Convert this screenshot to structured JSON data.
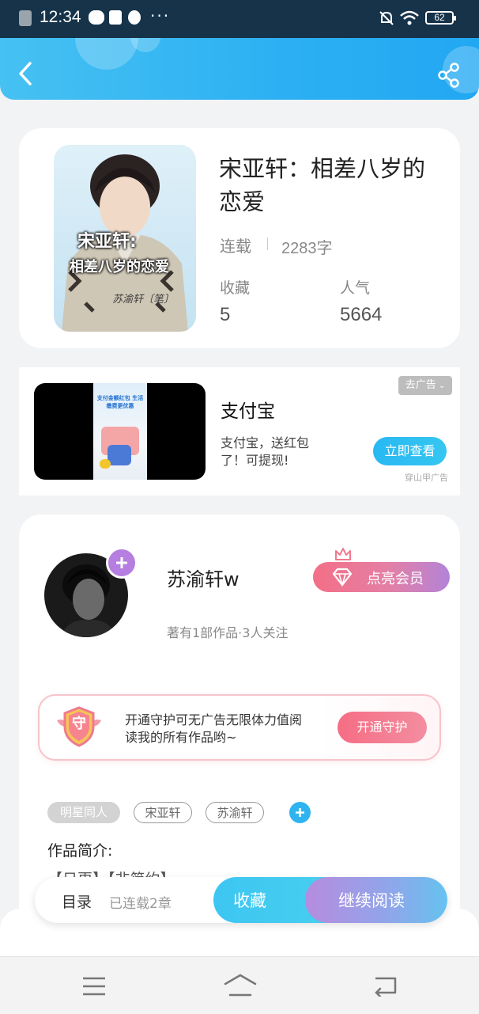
{
  "status_bar": {
    "time": "12:34",
    "dots": "···",
    "battery": "62"
  },
  "book": {
    "title": "宋亚轩：相差八岁的恋爱",
    "status": "连载",
    "word_count": "2283字",
    "favorites_label": "收藏",
    "favorites_value": "5",
    "popularity_label": "人气",
    "popularity_value": "5664",
    "cover_text_line1": "宋亚轩:",
    "cover_text_line2": "相差八岁的恋爱",
    "cover_author": "苏渝轩〔笔〕"
  },
  "ad": {
    "title": "支付宝",
    "desc": "支付宝，送红包了！可提现!",
    "cta": "立即查看",
    "remove": "去广告",
    "source": "穿山甲广告",
    "inner_text": "支付金额红包 生活缴费更优惠"
  },
  "author": {
    "name": "苏渝轩w",
    "stats": "著有1部作品·3人关注",
    "vip_button": "点亮会员"
  },
  "guard": {
    "badge": "守",
    "text": "开通守护可无广告无限体力值阅读我的所有作品哟~",
    "button": "开通守护"
  },
  "tags": [
    "明星同人",
    "宋亚轩",
    "苏渝轩"
  ],
  "intro_label": "作品简介:",
  "intro_text": "【日更】【非简约】...",
  "bottom": {
    "toc": "目录",
    "chapters": "已连载2章",
    "favorite": "收藏",
    "continue": "继续阅读"
  },
  "colors": {
    "accent": "#2cb0f3",
    "pink": "#f36f86",
    "purple": "#b383d8"
  }
}
